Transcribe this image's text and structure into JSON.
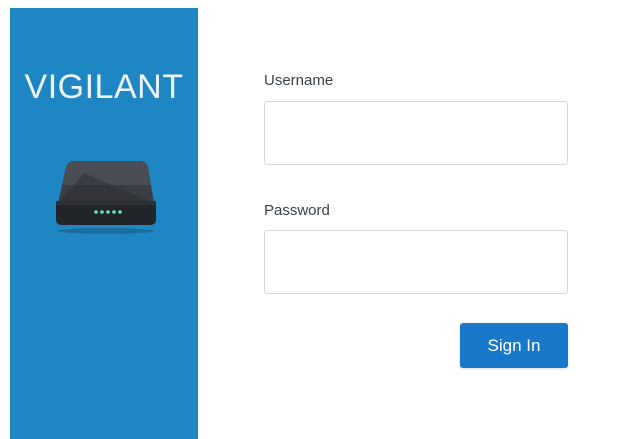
{
  "brand": {
    "name": "VIGILANT",
    "logo_icon": "router-icon",
    "sidebar_color": "#1f86c4"
  },
  "login_form": {
    "username_label": "Username",
    "username_value": "",
    "password_label": "Password",
    "password_value": "",
    "signin_label": "Sign In",
    "button_color": "#1878c9"
  }
}
